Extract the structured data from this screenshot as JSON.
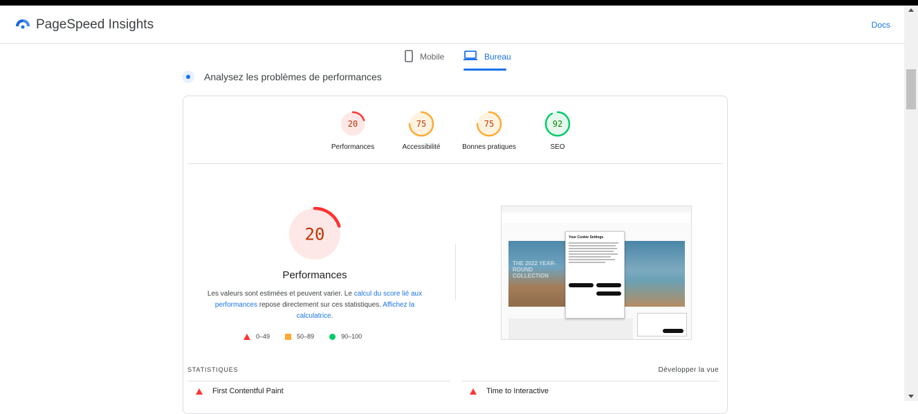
{
  "header": {
    "brand": "PageSpeed Insights",
    "docs_label": "Docs",
    "logo_icon": "pagespeed-logo-icon"
  },
  "tabs": [
    {
      "label": "Mobile",
      "icon": "phone-icon",
      "active": false
    },
    {
      "label": "Bureau",
      "icon": "laptop-icon",
      "active": true
    }
  ],
  "analyze": {
    "label": "Analysez les problèmes de performances"
  },
  "scores": [
    {
      "label": "Performances",
      "value": "20",
      "color": "#ff3333",
      "bg": "#fde8e7",
      "fraction": 0.2
    },
    {
      "label": "Accessibilité",
      "value": "75",
      "color": "#ffaa33",
      "bg": "#fff3e0",
      "fraction": 0.75
    },
    {
      "label": "Bonnes pratiques",
      "value": "75",
      "color": "#ffaa33",
      "bg": "#fff3e0",
      "fraction": 0.75
    },
    {
      "label": "SEO",
      "value": "92",
      "color": "#00cc66",
      "bg": "#e6f8ee",
      "fraction": 0.92
    }
  ],
  "main": {
    "score": "20",
    "fraction": 0.2,
    "title": "Performances",
    "desc_prefix": "Les valeurs sont estimées et peuvent varier. Le ",
    "desc_link1": "calcul du score lié aux performances",
    "desc_middle": " repose directement sur ces statistiques. ",
    "desc_link2": "Affichez la calculatrice",
    "desc_suffix": "."
  },
  "legend": [
    {
      "label": "0–49",
      "shape": "triangle",
      "color": "#ff3333"
    },
    {
      "label": "50–89",
      "shape": "square",
      "color": "#ffaa33"
    },
    {
      "label": "90–100",
      "shape": "circle",
      "color": "#00cc66"
    }
  ],
  "screenshot": {
    "dialog_title": "Your Cookie Settings",
    "hero_text": "THE 2022 YEAR-ROUND COLLECTION"
  },
  "stats": {
    "heading": "STATISTIQUES",
    "expand_label": "Développer la vue",
    "metrics": [
      {
        "label": "First Contentful Paint",
        "status": "fail"
      },
      {
        "label": "Time to Interactive",
        "status": "fail"
      }
    ]
  }
}
